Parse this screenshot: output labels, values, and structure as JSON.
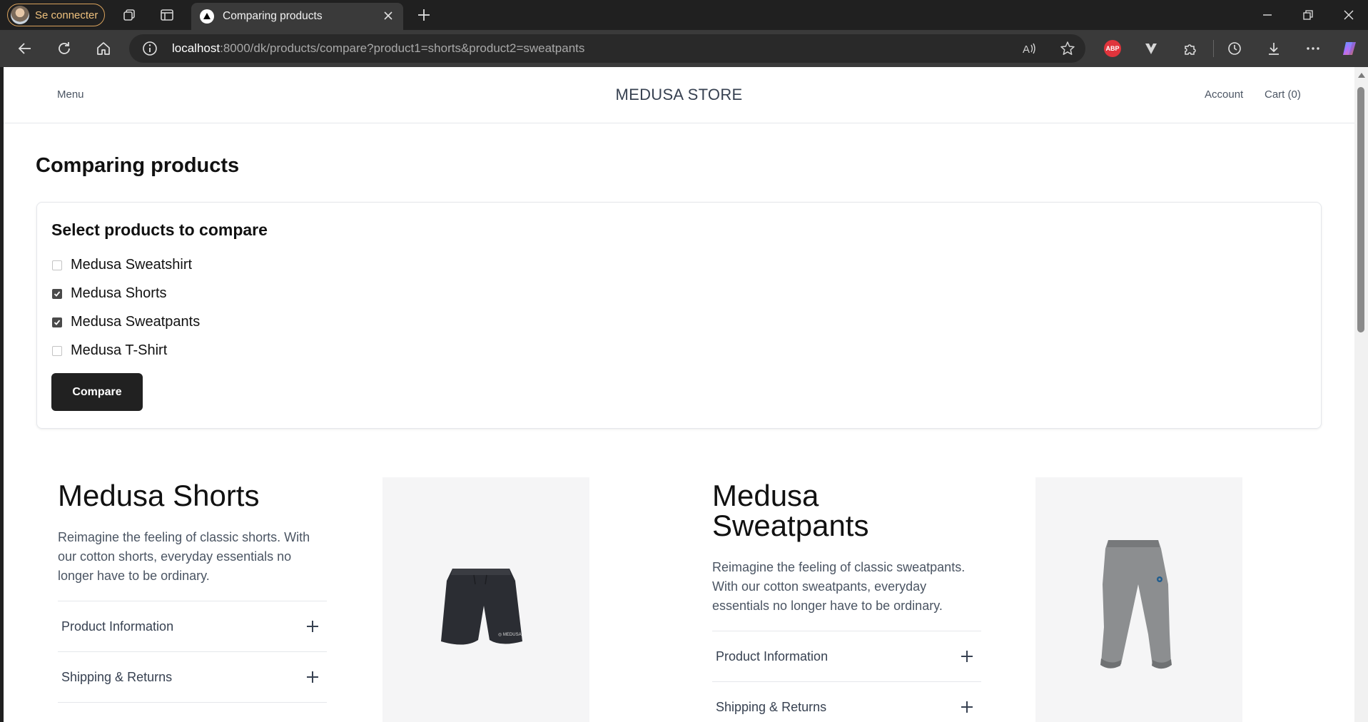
{
  "browser": {
    "profile_label": "Se connecter",
    "tab_title": "Comparing products",
    "url_host": "localhost",
    "url_rest": ":8000/dk/products/compare?product1=shorts&product2=sweatpants",
    "abp_label": "ABP"
  },
  "header": {
    "menu": "Menu",
    "brand": "MEDUSA STORE",
    "account": "Account",
    "cart": "Cart (0)"
  },
  "page": {
    "title": "Comparing products",
    "select_title": "Select products to compare",
    "options": [
      {
        "label": "Medusa Sweatshirt",
        "checked": false
      },
      {
        "label": "Medusa Shorts",
        "checked": true
      },
      {
        "label": "Medusa Sweatpants",
        "checked": true
      },
      {
        "label": "Medusa T-Shirt",
        "checked": false
      }
    ],
    "compare_button": "Compare"
  },
  "products": [
    {
      "name": "Medusa Shorts",
      "description": "Reimagine the feeling of classic shorts. With our cotton shorts, everyday essentials no longer have to be ordinary.",
      "accordion": [
        "Product Information",
        "Shipping & Returns"
      ]
    },
    {
      "name": "Medusa Sweatpants",
      "description": "Reimagine the feeling of classic sweatpants. With our cotton sweatpants, everyday essentials no longer have to be ordinary.",
      "accordion": [
        "Product Information",
        "Shipping & Returns"
      ]
    }
  ],
  "colors": {
    "chrome_bg": "#202020",
    "toolbar_bg": "#3a3a3a",
    "button_dark": "#212121",
    "profile_accent": "#d9a25c"
  }
}
